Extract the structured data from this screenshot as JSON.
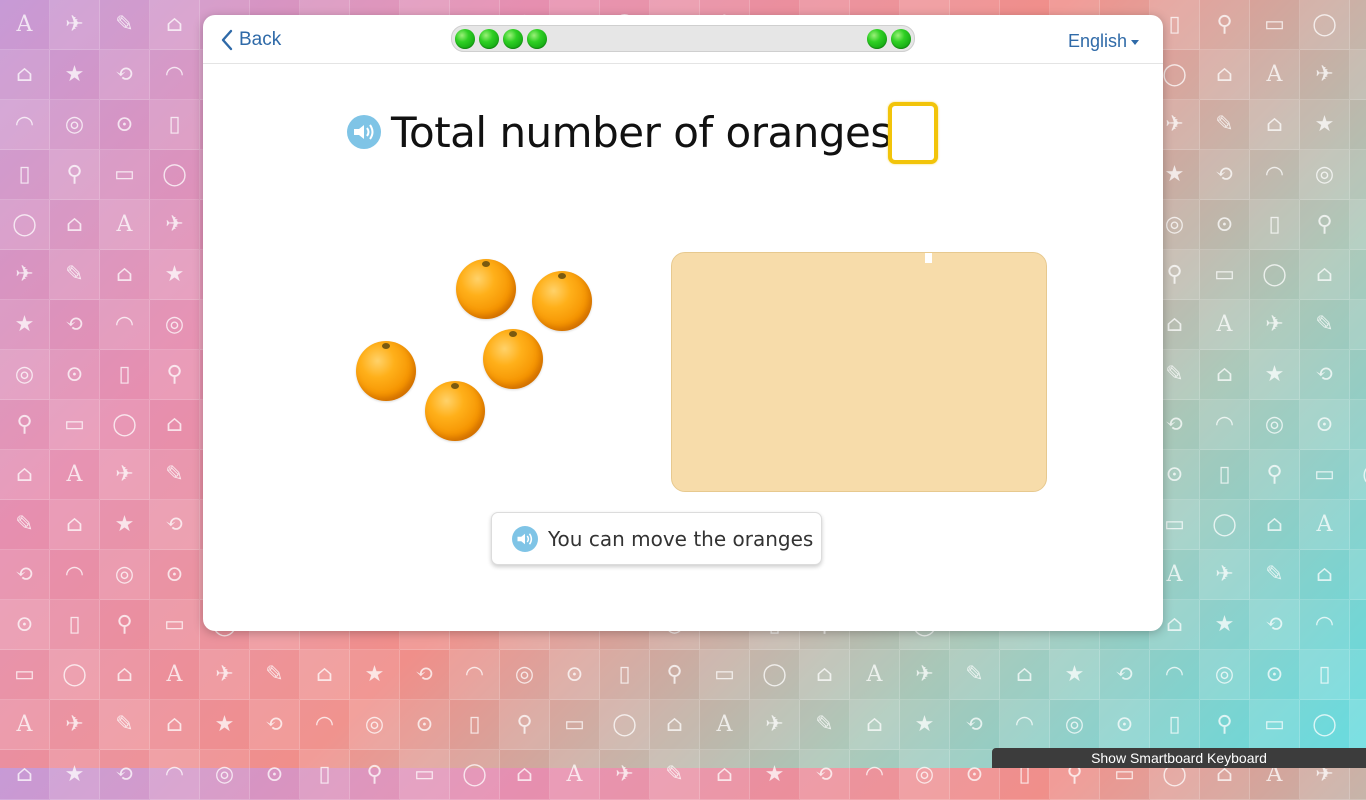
{
  "header": {
    "back_label": "Back",
    "language_label": "English",
    "progress_filled": 6
  },
  "question": {
    "text": "Total number of oranges?",
    "answer_value": ""
  },
  "oranges": {
    "count": 5
  },
  "hint": {
    "label": "You can move the oranges"
  },
  "footer": {
    "keyboard_label": "Show Smartboard Keyboard"
  },
  "colors": {
    "accent": "#2f6aa8",
    "answer_border": "#f2c40a",
    "dropzone": "#f7dcaa",
    "speaker": "#7fc4e6",
    "progress_dot": "#2fd024"
  },
  "background": {
    "icons": [
      "A",
      "✈",
      "✎",
      "⌂",
      "★",
      "⟲",
      "◠",
      "◎",
      "⊙",
      "▯",
      "⚲",
      "▭",
      "◯",
      "⌂"
    ]
  }
}
